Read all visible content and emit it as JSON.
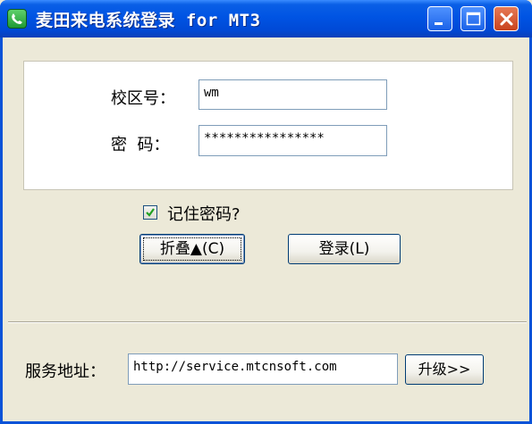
{
  "window": {
    "title": "麦田来电系统登录 for MT3"
  },
  "icons": {
    "app": "phone-icon",
    "minimize": "minimize-icon",
    "maximize": "maximize-icon",
    "close": "close-icon",
    "check": "check-icon"
  },
  "login": {
    "campus_label": "校区号：",
    "campus_value": "wm",
    "password_label": "密  码：",
    "password_value": "****************"
  },
  "remember": {
    "label": "记住密码?",
    "checked": true
  },
  "buttons": {
    "fold": "折叠▲(C)",
    "login": "登录(L)",
    "upgrade": "升级>>"
  },
  "service": {
    "label": "服务地址：",
    "url": "http://service.mtcnsoft.com"
  },
  "colors": {
    "titlebar": "#0054e3",
    "window_bg": "#ece9d8",
    "close_button": "#d4502a",
    "checkmark": "#21a121"
  }
}
